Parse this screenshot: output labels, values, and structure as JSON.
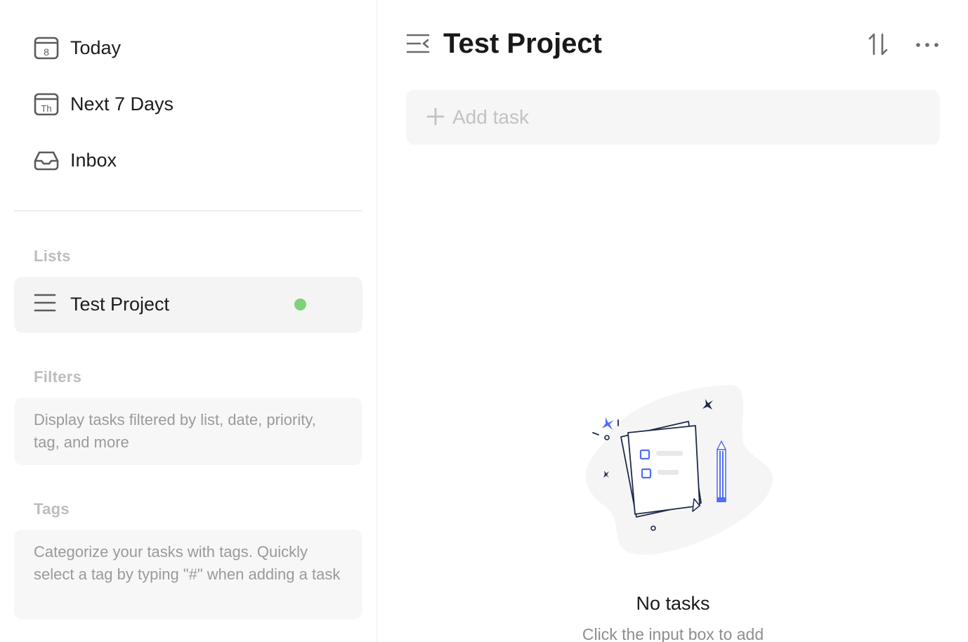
{
  "sidebar": {
    "nav": [
      {
        "label": "Today",
        "icon": "calendar-today-icon",
        "icon_text": "8"
      },
      {
        "label": "Next 7 Days",
        "icon": "calendar-week-icon",
        "icon_text": "Th"
      },
      {
        "label": "Inbox",
        "icon": "inbox-icon"
      }
    ],
    "lists_title": "Lists",
    "lists": [
      {
        "label": "Test Project",
        "icon": "list-icon",
        "dot_color": "#7ed27a"
      }
    ],
    "filters_title": "Filters",
    "filters_hint": "Display tasks filtered by list, date, priority, tag, and more",
    "tags_title": "Tags",
    "tags_hint": "Categorize your tasks with tags. Quickly select a tag by typing \"#\" when adding a task"
  },
  "main": {
    "title": "Test Project",
    "add_task": {
      "placeholder": "Add task",
      "value": ""
    },
    "empty_title": "No tasks",
    "empty_hint": "Click the input box to add"
  },
  "colors": {
    "accent": "#4f6ef7",
    "list_dot": "#7ed27a",
    "navy": "#1e2a4a"
  }
}
